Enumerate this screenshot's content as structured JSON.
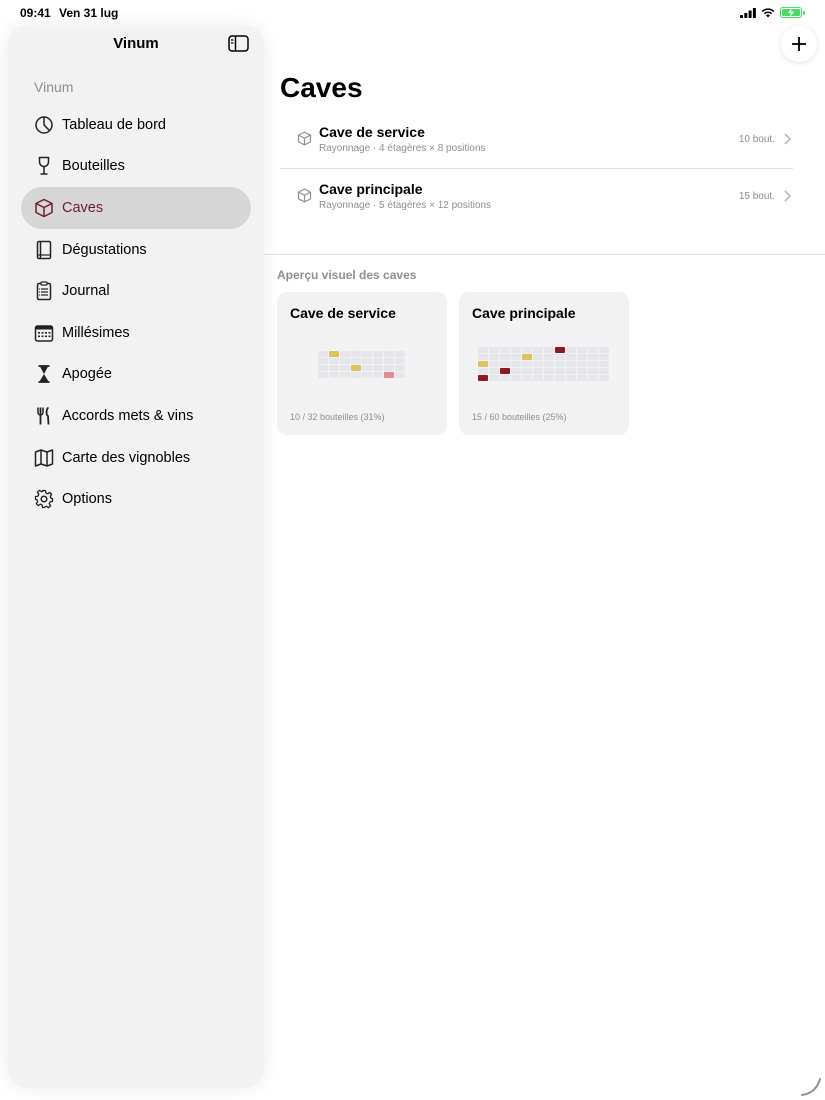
{
  "status": {
    "time": "09:41",
    "date": "Ven 31 lug"
  },
  "sidebar": {
    "title": "Vinum",
    "section": "Vinum",
    "items": [
      {
        "label": "Tableau de bord",
        "icon": "chart-pie-icon"
      },
      {
        "label": "Bouteilles",
        "icon": "wine-glass-icon"
      },
      {
        "label": "Caves",
        "icon": "cube-icon",
        "active": true
      },
      {
        "label": "Dégustations",
        "icon": "book-icon"
      },
      {
        "label": "Journal",
        "icon": "clipboard-icon"
      },
      {
        "label": "Millésimes",
        "icon": "calendar-icon"
      },
      {
        "label": "Apogée",
        "icon": "hourglass-icon"
      },
      {
        "label": "Accords mets & vins",
        "icon": "fork-knife-icon"
      },
      {
        "label": "Carte des vignobles",
        "icon": "map-icon"
      },
      {
        "label": "Options",
        "icon": "gear-icon"
      }
    ]
  },
  "main": {
    "title": "Caves",
    "caves": [
      {
        "name": "Cave de service",
        "subtitle": "Rayonnage · 4 étagères × 8 positions",
        "count": "10 bout."
      },
      {
        "name": "Cave principale",
        "subtitle": "Rayonnage · 5 étagères × 12 positions",
        "count": "15 bout."
      }
    ],
    "preview_heading": "Aperçu visuel des caves",
    "previews": [
      {
        "title": "Cave de service",
        "footer": "10 / 32 bouteilles (31%)",
        "shelves": 4,
        "positions": 8,
        "filled": {
          "0-1": "w",
          "2-3": "w",
          "3-6": "p"
        }
      },
      {
        "title": "Cave principale",
        "footer": "15 / 60 bouteilles (25%)",
        "shelves": 5,
        "positions": 12,
        "filled": {
          "0-7": "r",
          "1-4": "w",
          "2-0": "w",
          "3-2": "r",
          "4-0": "r"
        }
      }
    ]
  },
  "colors": {
    "accent": "#6b1e2e",
    "white_wine": "#dcc264",
    "red_wine": "#8b1a24",
    "rose_wine": "#e58a92"
  }
}
